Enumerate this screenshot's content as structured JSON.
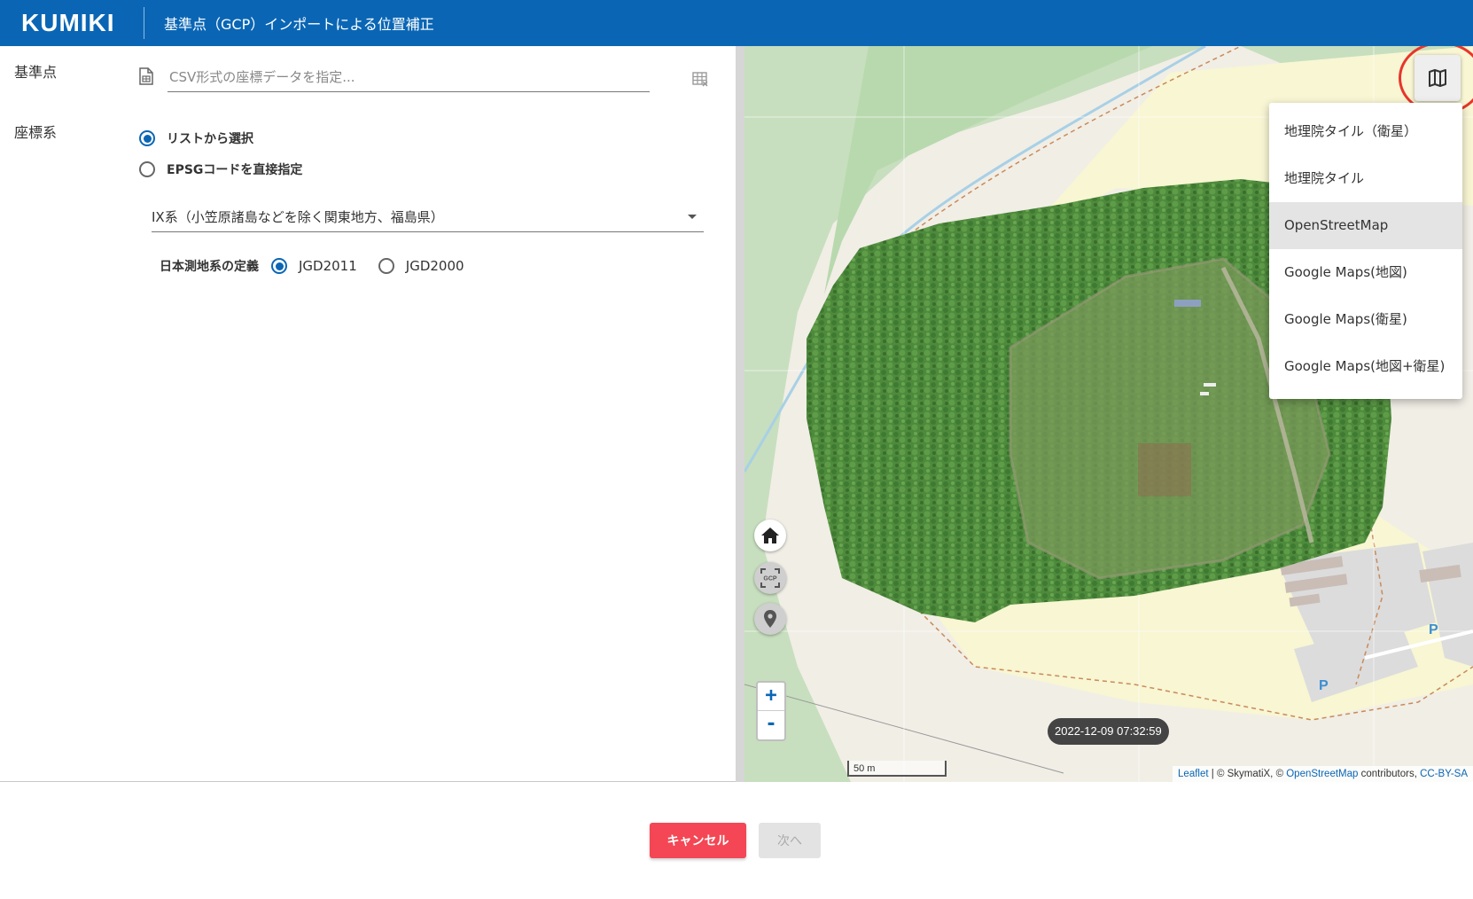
{
  "header": {
    "brand": "KUMIKI",
    "title": "基準点（GCP）インポートによる位置補正"
  },
  "form": {
    "gcp_label": "基準点",
    "csv_placeholder": "CSV形式の座標データを指定...",
    "crs_label": "座標系",
    "crs_options": [
      {
        "label": "リストから選択",
        "checked": true
      },
      {
        "label": "EPSGコードを直接指定",
        "checked": false
      }
    ],
    "zone_selected": "IX系（小笠原諸島などを除く関東地方、福島県）",
    "datum_label": "日本測地系の定義",
    "datum_options": [
      {
        "label": "JGD2011",
        "checked": true
      },
      {
        "label": "JGD2000",
        "checked": false
      }
    ]
  },
  "map": {
    "layer_menu": [
      {
        "label": "地理院タイル（衛星）",
        "selected": false
      },
      {
        "label": "地理院タイル",
        "selected": false
      },
      {
        "label": "OpenStreetMap",
        "selected": true
      },
      {
        "label": "Google Maps(地図)",
        "selected": false
      },
      {
        "label": "Google Maps(衛星)",
        "selected": false
      },
      {
        "label": "Google Maps(地図+衛星)",
        "selected": false
      }
    ],
    "zoom_in": "+",
    "zoom_out": "-",
    "timestamp": "2022-12-09 07:32:59",
    "scale_label": "50 m",
    "parking_label": "P",
    "gcp_icon_text": "GCP",
    "attribution": {
      "leaflet": "Leaflet",
      "sep": " | © SkymatiX, © ",
      "osm": "OpenStreetMap",
      "contributors": " contributors, ",
      "license": "CC-BY-SA"
    },
    "icons": [
      "layers-icon",
      "home-icon",
      "gcp-fit-icon",
      "map-pin-icon"
    ]
  },
  "footer": {
    "cancel_label": "キャンセル",
    "next_label": "次へ"
  },
  "colors": {
    "header_bg": "#0a66b5",
    "accent": "#0a66b5",
    "cancel": "#f44654",
    "ring": "#e8352b"
  }
}
